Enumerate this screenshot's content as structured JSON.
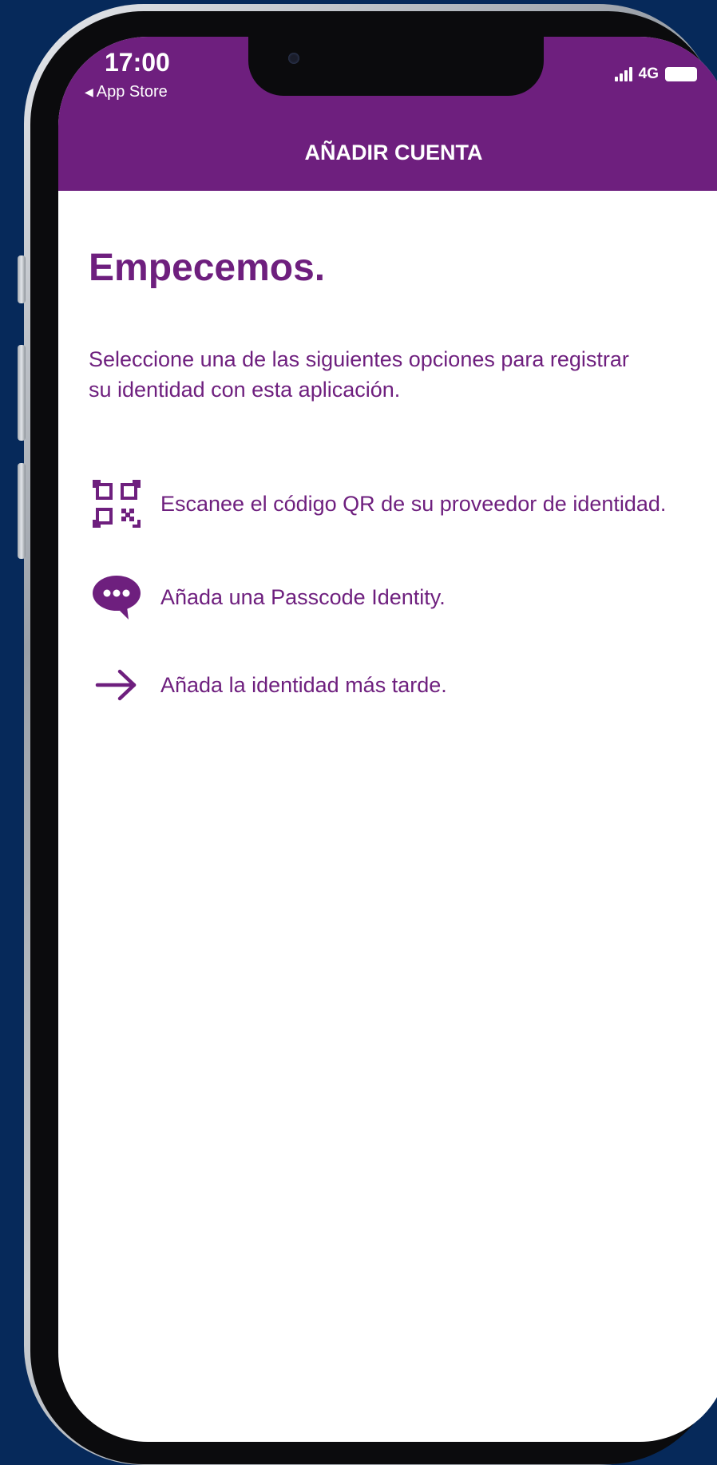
{
  "status_bar": {
    "time": "17:00",
    "back_app": "App Store",
    "network": "4G"
  },
  "header": {
    "title": "AÑADIR CUENTA"
  },
  "content": {
    "heading": "Empecemos.",
    "intro": "Seleccione una de las siguientes opciones para registrar su identidad con esta aplicación.",
    "options": [
      {
        "icon": "qr-code-icon",
        "label": "Escanee el código QR de su proveedor de identidad."
      },
      {
        "icon": "chat-bubble-icon",
        "label": "Añada una Passcode Identity."
      },
      {
        "icon": "arrow-right-icon",
        "label": "Añada la identidad más tarde."
      }
    ]
  },
  "colors": {
    "accent": "#6e1f7e",
    "background": "#06295a",
    "screen": "#ffffff"
  }
}
